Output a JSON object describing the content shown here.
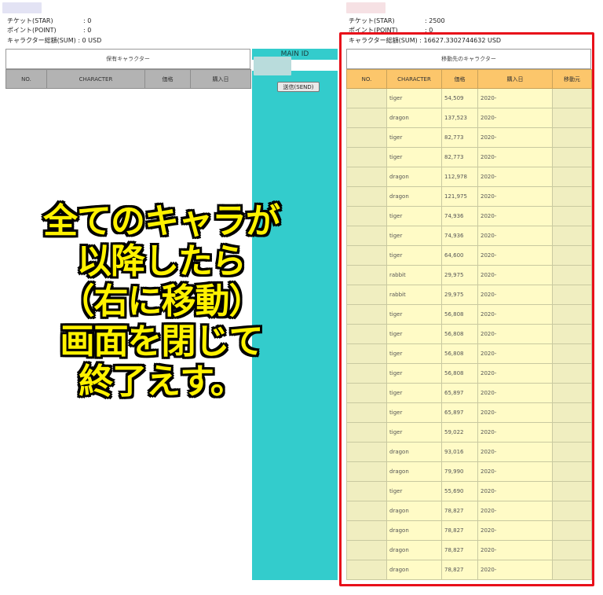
{
  "left_stats": {
    "ticket_label": "チケット(STAR)",
    "ticket_value": ": 0",
    "point_label": "ポイント(POINT)",
    "point_value": ": 0",
    "sum_label": "キャラクター総額(SUM)",
    "sum_value": ": 0 USD"
  },
  "right_stats": {
    "ticket_label": "チケット(STAR)",
    "ticket_value": ": 2500",
    "point_label": "ポイント(POINT)",
    "point_value": ": 0",
    "sum_text": "キャラクター総額(SUM) : 16627.3302744632 USD"
  },
  "left_panel": {
    "title": "保有キャラクター",
    "headers": [
      "NO.",
      "CHARACTER",
      "価格",
      "購入日"
    ]
  },
  "middle": {
    "main_id_label": "MAIN ID",
    "send_button": "送信(SEND)"
  },
  "right_panel": {
    "title": "移動先のキャラクター",
    "headers": [
      "NO.",
      "CHARACTER",
      "価格",
      "購入日",
      "移動元"
    ],
    "date_prefix": "2020-",
    "rows": [
      {
        "character": "tiger",
        "price": "54,509"
      },
      {
        "character": "dragon",
        "price": "137,523"
      },
      {
        "character": "tiger",
        "price": "82,773"
      },
      {
        "character": "tiger",
        "price": "82,773"
      },
      {
        "character": "dragon",
        "price": "112,978"
      },
      {
        "character": "dragon",
        "price": "121,975"
      },
      {
        "character": "tiger",
        "price": "74,936"
      },
      {
        "character": "tiger",
        "price": "74,936"
      },
      {
        "character": "tiger",
        "price": "64,600"
      },
      {
        "character": "rabbit",
        "price": "29,975"
      },
      {
        "character": "rabbit",
        "price": "29,975"
      },
      {
        "character": "tiger",
        "price": "56,808"
      },
      {
        "character": "tiger",
        "price": "56,808"
      },
      {
        "character": "tiger",
        "price": "56,808"
      },
      {
        "character": "tiger",
        "price": "56,808"
      },
      {
        "character": "tiger",
        "price": "65,897"
      },
      {
        "character": "tiger",
        "price": "65,897"
      },
      {
        "character": "tiger",
        "price": "59,022"
      },
      {
        "character": "dragon",
        "price": "93,016"
      },
      {
        "character": "dragon",
        "price": "79,990"
      },
      {
        "character": "tiger",
        "price": "55,690"
      },
      {
        "character": "dragon",
        "price": "78,827"
      },
      {
        "character": "dragon",
        "price": "78,827"
      },
      {
        "character": "dragon",
        "price": "78,827"
      },
      {
        "character": "dragon",
        "price": "78,827"
      }
    ]
  },
  "overlay": {
    "lines": [
      "全てのキャラが",
      "以降したら",
      "（右に移動）",
      "画面を閉じて",
      "終了えす。"
    ]
  },
  "colors": {
    "accent_teal": "#33cccc",
    "header_orange": "#fcc66b",
    "row_yellow": "#fffbc6",
    "highlight_red": "#e8101a",
    "overlay_text": "#fff200"
  }
}
